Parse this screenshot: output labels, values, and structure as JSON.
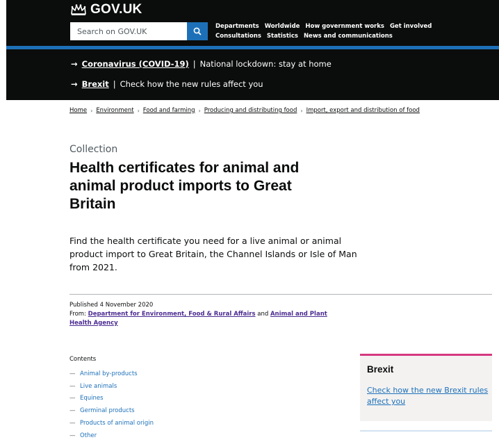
{
  "header": {
    "logo_text": "GOV.UK",
    "search": {
      "placeholder": "Search on GOV.UK"
    },
    "nav_row_1": [
      "Departments",
      "Worldwide",
      "How government works",
      "Get involved"
    ],
    "nav_row_2": [
      "Consultations",
      "Statistics",
      "News and communications"
    ]
  },
  "banner": {
    "covid_link": "Coronavirus (COVID-19)",
    "covid_text": "National lockdown: stay at home",
    "brexit_link": "Brexit",
    "brexit_text": "Check how the new rules affect you"
  },
  "breadcrumbs": [
    "Home",
    "Environment",
    "Food and farming",
    "Producing and distributing food",
    "Import, export and distribution of food"
  ],
  "caption": "Collection",
  "title": "Health certificates for animal and animal product imports to Great Britain",
  "lead": "Find the health certificate you need for a live animal or animal product import to Great Britain, the Channel Islands or Isle of Man from 2021.",
  "meta": {
    "published": "Published 4 November 2020",
    "from_label": "From:",
    "org_1": "Department for Environment, Food & Rural Affairs",
    "and": "and",
    "org_2": "Animal and Plant Health Agency"
  },
  "contents": {
    "heading": "Contents",
    "items": [
      "Animal by-products",
      "Live animals",
      "Equines",
      "Germinal products",
      "Products of animal origin",
      "Other"
    ]
  },
  "sidebar": {
    "title": "Brexit",
    "link": "Check how the new Brexit rules affect you"
  },
  "colors": {
    "header_bg": "#0b0c0c",
    "brand_blue": "#1d70b8",
    "link_visited": "#4c2c92",
    "brexit_accent": "#d53880"
  }
}
